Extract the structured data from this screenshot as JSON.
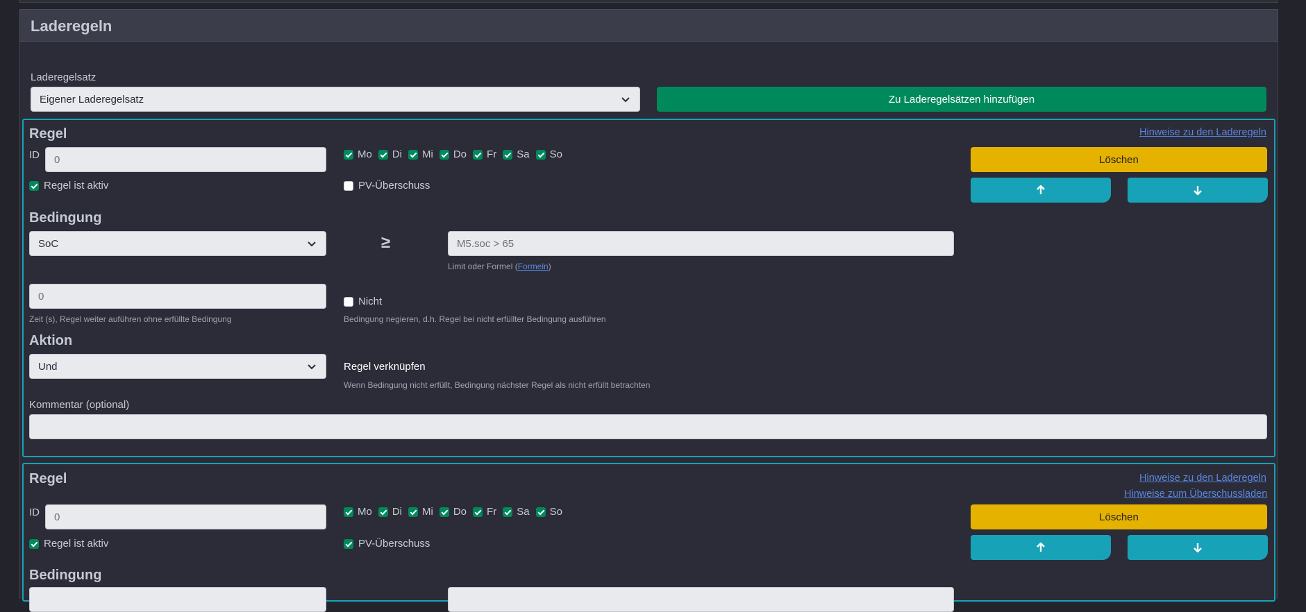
{
  "card": {
    "title": "Laderegeln"
  },
  "ruleset": {
    "label": "Laderegelsatz",
    "selected": "Eigener Laderegelsatz",
    "add_button": "Zu Laderegelsätzen hinzufügen"
  },
  "rule1": {
    "title": "Regel",
    "hints_link": "Hinweise zu den Laderegeln",
    "id_label": "ID",
    "id_value": "0",
    "days": [
      {
        "label": "Mo",
        "checked": true
      },
      {
        "label": "Di",
        "checked": true
      },
      {
        "label": "Mi",
        "checked": true
      },
      {
        "label": "Do",
        "checked": true
      },
      {
        "label": "Fr",
        "checked": true
      },
      {
        "label": "Sa",
        "checked": true
      },
      {
        "label": "So",
        "checked": true
      }
    ],
    "active_label": "Regel ist aktiv",
    "active_checked": true,
    "pv_label": "PV-Überschuss",
    "pv_checked": false,
    "delete_button": "Löschen",
    "condition": {
      "title": "Bedingung",
      "source": "SoC",
      "operator": "≥",
      "limit_value": "M5.soc > 65",
      "limit_help_prefix": "Limit oder Formel (",
      "limit_help_link": "Formeln",
      "limit_help_suffix": ")",
      "time_value": "0",
      "time_help": "Zeit (s), Regel weiter auführen ohne erfüllte Bedingung",
      "not_label": "Nicht",
      "not_help": "Bedingung negieren, d.h. Regel bei nicht erfüllter Bedingung ausführen"
    },
    "action": {
      "title": "Aktion",
      "selected": "Und",
      "link_title": "Regel verknüpfen",
      "link_help": "Wenn Bedingung nicht erfüllt, Bedingung nächster Regel als nicht erfüllt betrachten"
    },
    "comment_label": "Kommentar (optional)",
    "comment_value": ""
  },
  "rule2": {
    "title": "Regel",
    "hints_link": "Hinweise zu den Laderegeln",
    "hints_link2": "Hinweise zum Überschussladen",
    "id_label": "ID",
    "id_value": "0",
    "active_label": "Regel ist aktiv",
    "pv_label": "PV-Überschuss",
    "delete_button": "Löschen",
    "condition_title": "Bedingung"
  },
  "icons": {
    "up": "arrow-up-icon",
    "down": "arrow-down-icon",
    "chevron": "chevron-down-icon"
  },
  "colors": {
    "accent_teal": "#17a2b8",
    "green": "#008a5c",
    "yellow": "#e6b200",
    "background": "#23232c"
  }
}
